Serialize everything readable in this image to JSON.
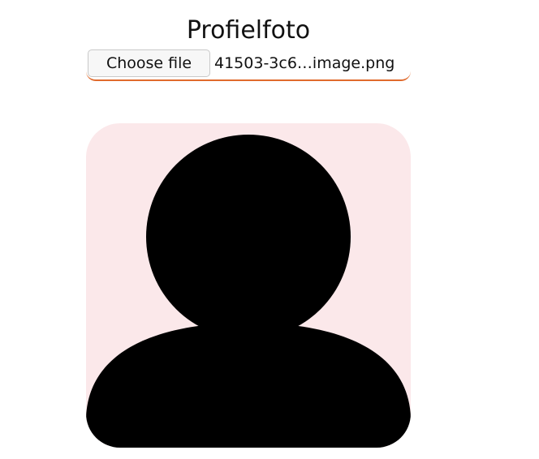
{
  "profile": {
    "title": "Profielfoto",
    "file_input": {
      "button_label": "Choose file",
      "file_name": "41503-3c6…image.png"
    }
  },
  "avatar": {
    "icon": "person-silhouette-icon",
    "background_color": "#fbe8ea",
    "silhouette_color": "#000000"
  },
  "colors": {
    "accent_underline": "#e06a2c"
  }
}
